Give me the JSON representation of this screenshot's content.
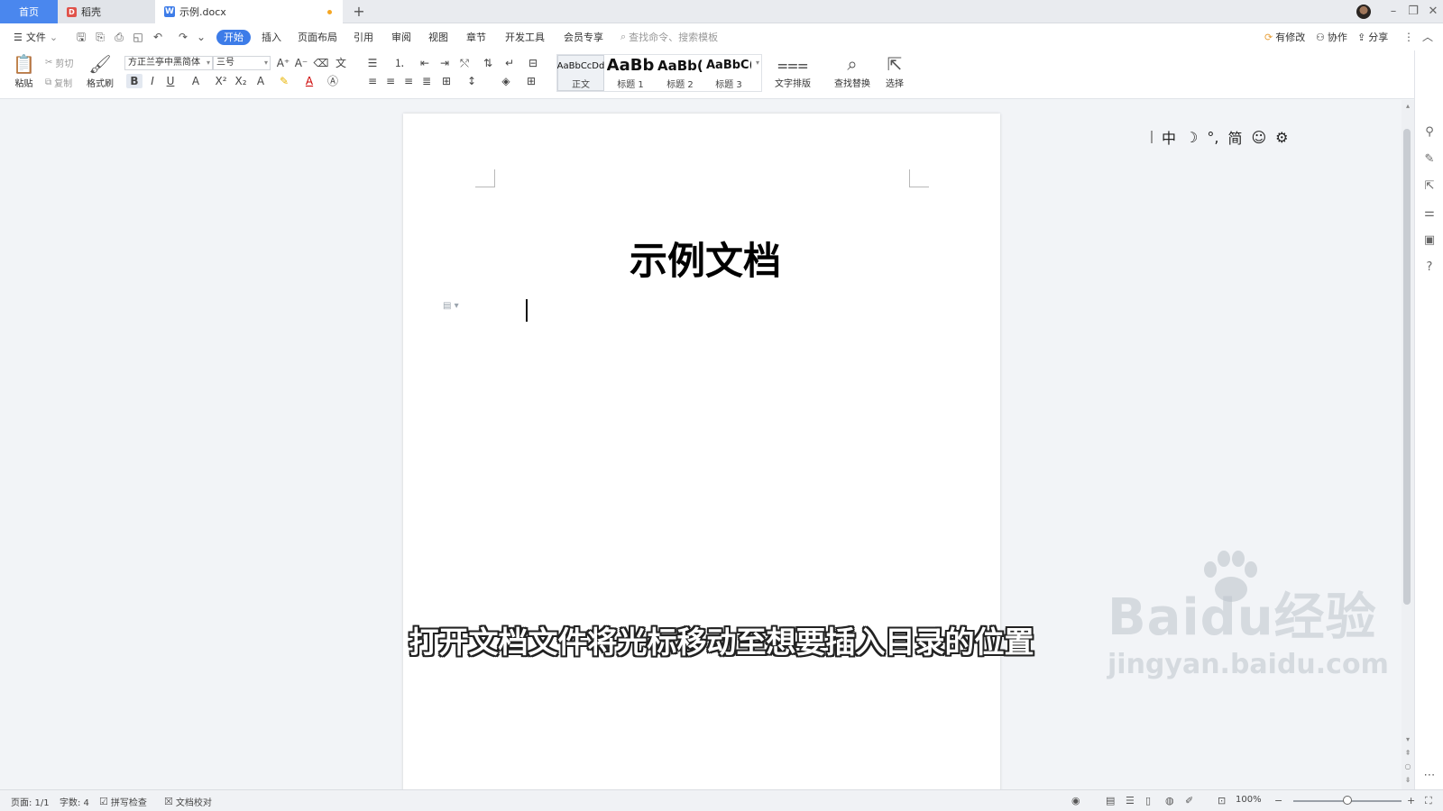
{
  "tabs": {
    "home": "首页",
    "daoke": "稻壳",
    "doc": "示例.docx",
    "new": "+"
  },
  "window": {
    "minimize": "–",
    "restore": "❐",
    "close": "✕"
  },
  "menu": {
    "file": "文件",
    "items": [
      "开始",
      "插入",
      "页面布局",
      "引用",
      "审阅",
      "视图",
      "章节",
      "开发工具",
      "会员专享"
    ],
    "search_placeholder": "查找命令、搜索模板",
    "has_changes": "有修改",
    "collab": "协作",
    "share": "分享"
  },
  "ribbon": {
    "paste": "粘贴",
    "cut": "剪切",
    "copy": "复制",
    "format_painter": "格式刷",
    "font_name": "方正兰亭中黑简体",
    "font_size": "三号",
    "styles": [
      {
        "sample": "AaBbCcDd",
        "name": "正文"
      },
      {
        "sample": "AaBb",
        "name": "标题 1"
      },
      {
        "sample": "AaBb(",
        "name": "标题 2"
      },
      {
        "sample": "AaBbC(",
        "name": "标题 3"
      }
    ],
    "text_layout": "文字排版",
    "find_replace": "查找替换",
    "select": "选择"
  },
  "document": {
    "title": "示例文档"
  },
  "ime": {
    "lang": "中",
    "width": "简"
  },
  "subtitle": "打开文档文件将光标移动至想要插入目录的位置",
  "watermark": {
    "main": "Baidu经验",
    "sub": "jingyan.baidu.com"
  },
  "status": {
    "page": "页面: 1/1",
    "words": "字数: 4",
    "spell": "拼写检查",
    "proof": "文档校对",
    "zoom": "100%",
    "zoom_level": 0.5
  },
  "colors": {
    "accent": "#3d7ce8",
    "home_tab": "#4a87ee"
  }
}
